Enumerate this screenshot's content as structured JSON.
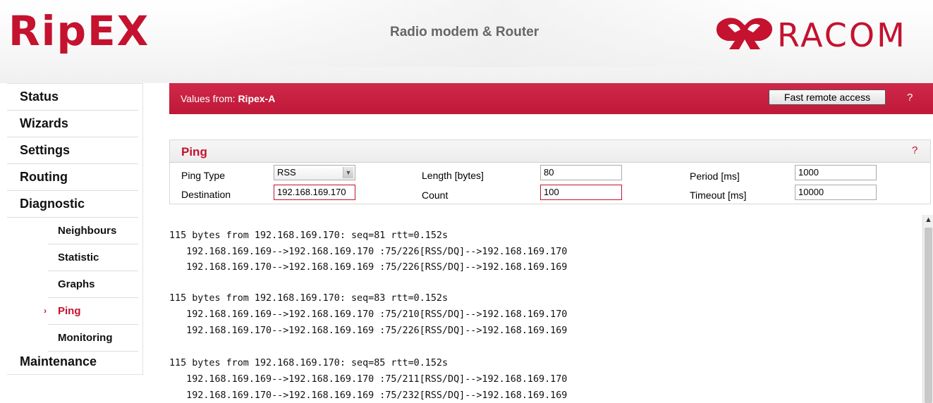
{
  "header": {
    "logo_text": "RipEX",
    "tagline": "Radio modem & Router",
    "brand": "RACOM"
  },
  "sidebar": {
    "items": [
      {
        "label": "Status"
      },
      {
        "label": "Wizards"
      },
      {
        "label": "Settings"
      },
      {
        "label": "Routing"
      },
      {
        "label": "Diagnostic"
      }
    ],
    "sub_items": [
      {
        "label": "Neighbours"
      },
      {
        "label": "Statistic"
      },
      {
        "label": "Graphs"
      },
      {
        "label": "Ping",
        "active": true
      },
      {
        "label": "Monitoring"
      }
    ],
    "active_marker": "›",
    "maintenance": "Maintenance"
  },
  "values_bar": {
    "prefix": "Values from: ",
    "device": "Ripex-A",
    "fast_remote_access": "Fast remote access",
    "help": "?"
  },
  "ping": {
    "title": "Ping",
    "help": "?",
    "ping_type_label": "Ping Type",
    "ping_type_value": "RSS",
    "destination_label": "Destination",
    "destination_value": "192.168.169.170",
    "length_label": "Length [bytes]",
    "length_value": "80",
    "count_label": "Count",
    "count_value": "100",
    "period_label": "Period [ms]",
    "period_value": "1000",
    "timeout_label": "Timeout [ms]",
    "timeout_value": "10000"
  },
  "output": {
    "lines": [
      "115 bytes from 192.168.169.170: seq=81 rtt=0.152s",
      "   192.168.169.169-->192.168.169.170 :75/226[RSS/DQ]-->192.168.169.170",
      "   192.168.169.170-->192.168.169.169 :75/226[RSS/DQ]-->192.168.169.169",
      "",
      "115 bytes from 192.168.169.170: seq=83 rtt=0.152s",
      "   192.168.169.169-->192.168.169.170 :75/210[RSS/DQ]-->192.168.169.170",
      "   192.168.169.170-->192.168.169.169 :75/226[RSS/DQ]-->192.168.169.169",
      "",
      "115 bytes from 192.168.169.170: seq=85 rtt=0.152s",
      "   192.168.169.169-->192.168.169.170 :75/211[RSS/DQ]-->192.168.169.170",
      "   192.168.169.170-->192.168.169.169 :75/232[RSS/DQ]-->192.168.169.169"
    ]
  },
  "colors": {
    "brand_red": "#c4122f",
    "bar_red": "#c4203f"
  }
}
